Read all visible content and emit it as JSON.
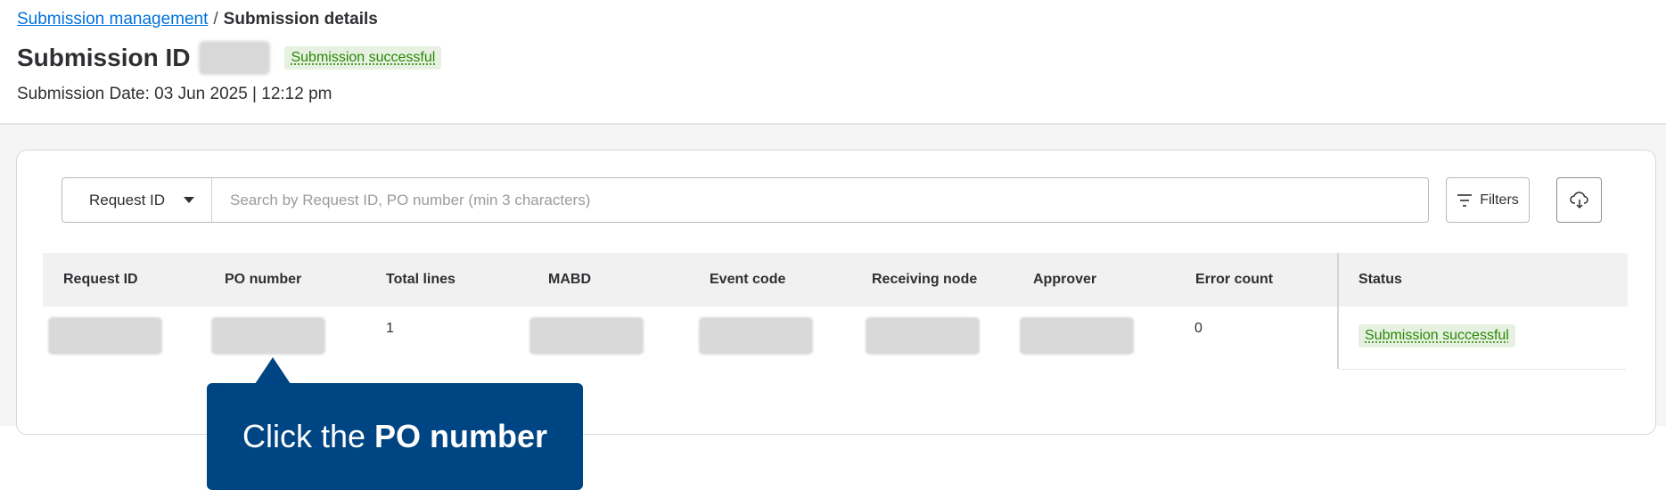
{
  "breadcrumb": {
    "parent_label": "Submission management",
    "separator": "/",
    "current_label": "Submission details"
  },
  "page": {
    "title": "Submission ID",
    "status_badge": "Submission successful",
    "submission_date": "Submission Date: 03 Jun 2025 | 12:12 pm"
  },
  "search": {
    "field_select_value": "Request ID",
    "placeholder": "Search by Request ID, PO number (min 3 characters)",
    "filters_label": "Filters"
  },
  "table": {
    "columns": [
      "Request ID",
      "PO number",
      "Total lines",
      "MABD",
      "Event code",
      "Receiving node",
      "Approver",
      "Error count",
      "Status"
    ],
    "rows": [
      {
        "request_id": "",
        "po_number": "",
        "total_lines": "1",
        "mabd": "",
        "event_code": "",
        "receiving_node": "",
        "approver": "",
        "error_count": "0",
        "status": "Submission successful"
      }
    ]
  },
  "tooltip": {
    "prefix": "Click the",
    "emphasis": "PO number"
  },
  "icons": {
    "caret": "chevron-down-icon",
    "filters": "filter-lines-icon",
    "download": "cloud-download-icon"
  },
  "colors": {
    "link": "#0071dc",
    "success_text": "#2a8703",
    "success_bg": "#e6f1e2",
    "tooltip_bg": "#004583"
  }
}
